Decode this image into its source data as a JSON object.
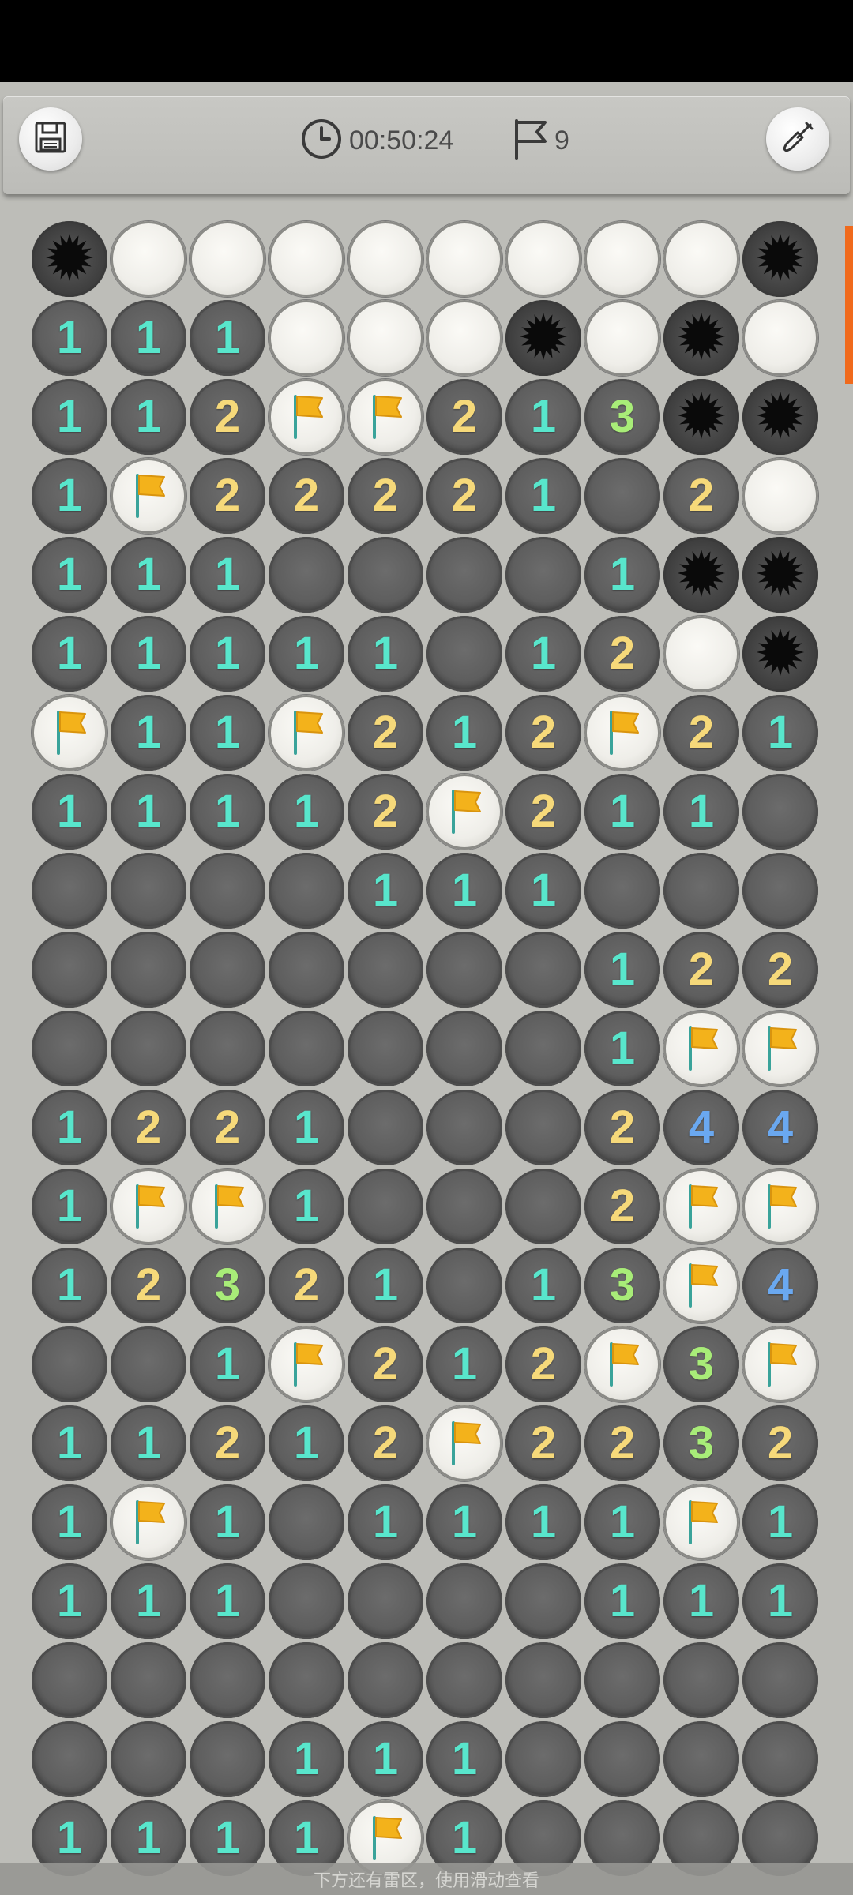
{
  "toolbar": {
    "save_icon": "floppy-disk-icon",
    "timer_icon": "clock-icon",
    "timer": "00:50:24",
    "flag_icon": "flag-icon",
    "flags_count": "9",
    "tool_icon": "shovel-icon"
  },
  "colors": {
    "n1": "#58e6cc",
    "n2": "#f6d97a",
    "n3": "#a8ec78",
    "n4": "#6aa8f0",
    "accent": "#f06a1c"
  },
  "legend": {
    "M": "mine",
    "H": "hidden",
    "F": "flag",
    "E": "revealed-empty",
    "1-4": "revealed-number"
  },
  "board": {
    "columns": 10,
    "rows": [
      "MHHHHHHHHM",
      "111HHHMHMH",
      "112FF213MM",
      "1F22221E2HH",
      "111EEEE1MM",
      "11111E12HM",
      "F11F212F21",
      "11112F211E",
      "EEEE111EEE",
      "EEEEEEE122",
      "EEEEEEE1FF",
      "1221EEE244",
      "1FF1EEE2FF",
      "12321E13F4",
      "EE1F212F3F",
      "11212F2232",
      "1F1E1111F1",
      "111EEEE111",
      "EEEEEEEEEE",
      "EEE111EEEE",
      "1111F1EEEE"
    ]
  },
  "hint": "下方还有雷区，使用滑动查看"
}
